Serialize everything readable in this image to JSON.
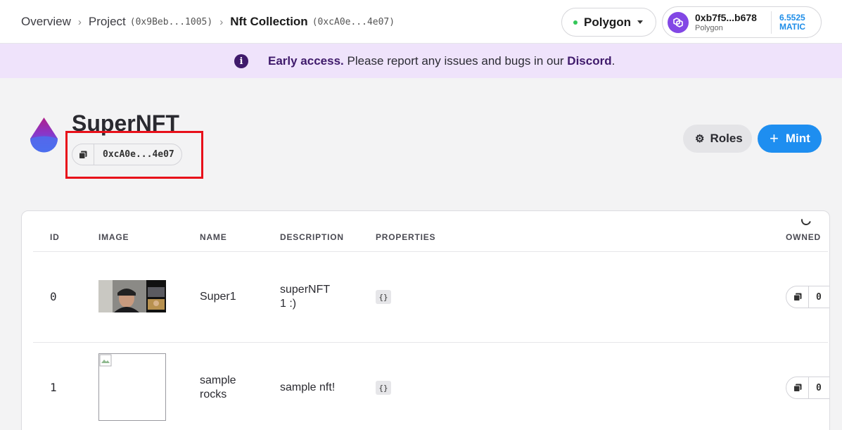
{
  "breadcrumb": {
    "overview": "Overview",
    "project_label": "Project",
    "project_addr": "(0x9Beb...1005)",
    "collection_label": "Nft Collection",
    "collection_addr": "(0xcA0e...4e07)"
  },
  "network": {
    "label": "Polygon",
    "status_color": "#34c759"
  },
  "wallet": {
    "address": "0xb7f5...b678",
    "network": "Polygon",
    "balance_amount": "6.5525",
    "balance_unit": "MATIC"
  },
  "banner": {
    "strong": "Early access.",
    "text": " Please report any issues and bugs in our ",
    "link": "Discord",
    "end": "."
  },
  "collection": {
    "name": "SuperNFT",
    "address": "0xcA0e...4e07"
  },
  "actions": {
    "roles": "Roles",
    "mint": "Mint"
  },
  "table": {
    "headers": [
      "ID",
      "IMAGE",
      "NAME",
      "DESCRIPTION",
      "PROPERTIES",
      "OWNED"
    ],
    "rows": [
      {
        "id": "0",
        "name_line1": "Super1",
        "name_line2": "",
        "desc_line1": "superNFT",
        "desc_line2": "1 :)",
        "props": "{}",
        "owner": "0"
      },
      {
        "id": "1",
        "name_line1": "sample",
        "name_line2": "rocks",
        "desc_line1": "sample nft!",
        "desc_line2": "",
        "props": "{}",
        "owner": "0"
      }
    ]
  },
  "colors": {
    "accent": "#1e8ef0",
    "banner_bg": "#efe3fb",
    "highlight": "#e8101a",
    "polygon": "#8247e5"
  }
}
